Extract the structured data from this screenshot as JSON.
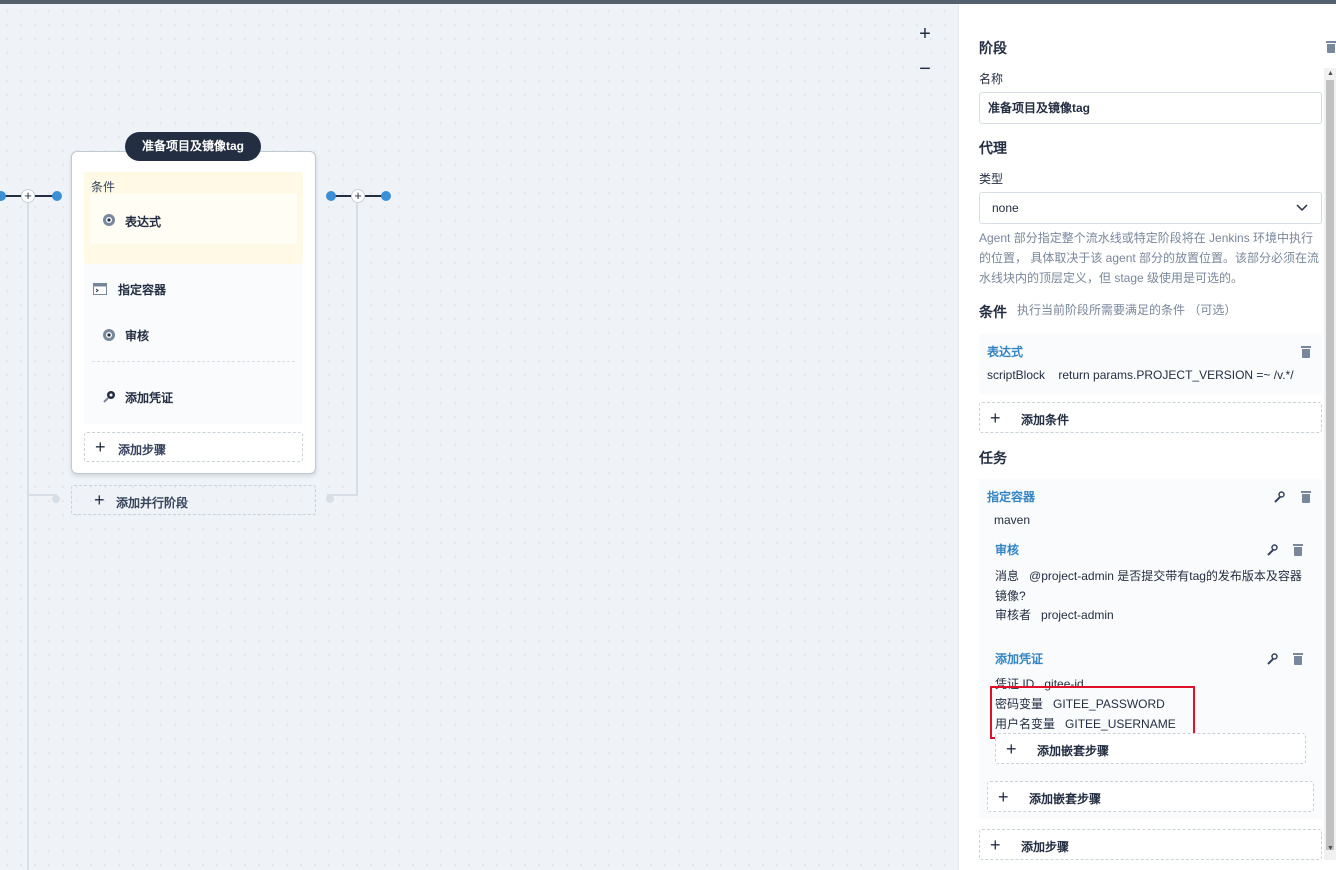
{
  "canvas": {
    "zoom_in": "+",
    "zoom_out": "−",
    "stage": {
      "title": "准备项目及镜像tag",
      "condition_label": "条件",
      "condition_item": "表达式",
      "steps": [
        "指定容器",
        "审核",
        "添加凭证"
      ],
      "add_step": "添加步骤"
    },
    "add_parallel_stage": "添加并行阶段"
  },
  "panel": {
    "stage_heading": "阶段",
    "name_label": "名称",
    "name_value": "准备项目及镜像tag",
    "agent_heading": "代理",
    "type_label": "类型",
    "type_value": "none",
    "agent_desc": "Agent 部分指定整个流水线或特定阶段将在 Jenkins 环境中执行的位置， 具体取决于该 agent 部分的放置位置。该部分必须在流水线块内的顶层定义，但 stage 级使用是可选的。",
    "condition_heading": "条件",
    "condition_hint": "执行当前阶段所需要满足的条件 （可选）",
    "condition": {
      "title": "表达式",
      "key": "scriptBlock",
      "value": "return params.PROJECT_VERSION =~ /v.*/"
    },
    "add_condition": "添加条件",
    "tasks_heading": "任务",
    "container": {
      "title": "指定容器",
      "value": "maven"
    },
    "review": {
      "title": "审核",
      "msg_key": "消息",
      "msg_value": "@project-admin 是否提交带有tag的发布版本及容器镜像?",
      "msg_line1": "消息   @project-admin 是否提交带有tag的发布版本及容器",
      "msg_line2": "镜像?",
      "reviewer_key": "审核者",
      "reviewer_value": "project-admin"
    },
    "credential": {
      "title": "添加凭证",
      "id_key": "凭证 ID",
      "id_value": "gitee-id",
      "pwd_key": "密码变量",
      "pwd_value": "GITEE_PASSWORD",
      "user_key": "用户名变量",
      "user_value": "GITEE_USERNAME"
    },
    "add_nested_step_inner": "添加嵌套步骤",
    "add_nested_step_outer": "添加嵌套步骤",
    "add_step": "添加步骤"
  },
  "colors": {
    "accent_blue": "#3385c4",
    "highlight_red": "#e0102a",
    "dark": "#242e42"
  }
}
